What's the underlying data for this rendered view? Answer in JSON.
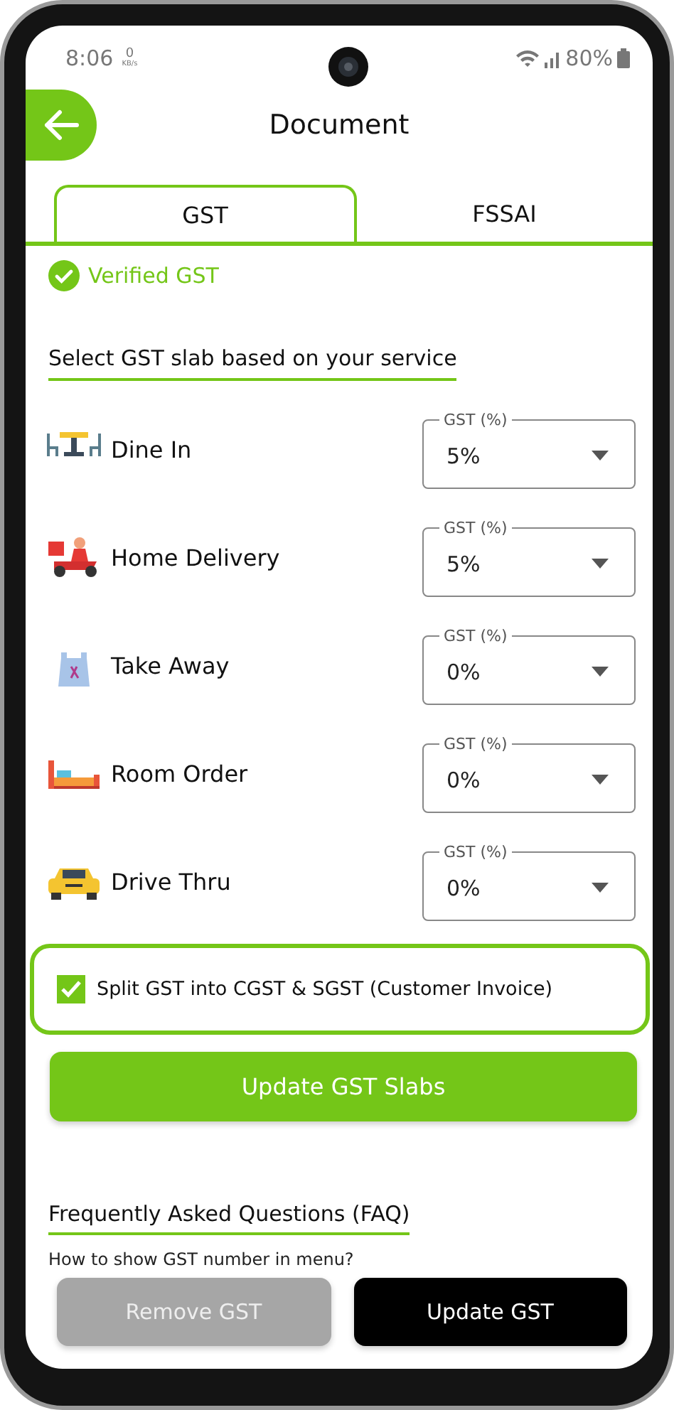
{
  "status_bar": {
    "time": "8:06",
    "net_speed_value": "0",
    "net_speed_unit": "KB/s",
    "battery": "80%"
  },
  "header": {
    "title": "Document"
  },
  "tabs": [
    {
      "label": "GST",
      "selected": true
    },
    {
      "label": "FSSAI",
      "selected": false
    }
  ],
  "verification": {
    "label": "Verified GST",
    "checked": true
  },
  "slab_section": {
    "heading": "Select GST slab based on your service"
  },
  "services": [
    {
      "kind": "dine",
      "name": "Dine In",
      "field_label": "GST (%)",
      "value": "5%"
    },
    {
      "kind": "delivery",
      "name": "Home Delivery",
      "field_label": "GST (%)",
      "value": "5%"
    },
    {
      "kind": "takeaway",
      "name": "Take Away",
      "field_label": "GST (%)",
      "value": "0%"
    },
    {
      "kind": "room",
      "name": "Room Order",
      "field_label": "GST (%)",
      "value": "0%"
    },
    {
      "kind": "drive",
      "name": "Drive Thru",
      "field_label": "GST (%)",
      "value": "0%"
    }
  ],
  "split_option": {
    "label": "Split GST into CGST & SGST (Customer Invoice)",
    "checked": true
  },
  "update_slabs_button": "Update GST Slabs",
  "faq": {
    "heading": "Frequently Asked Questions (FAQ)",
    "questions": [
      {
        "question": "How to show GST number in menu?"
      }
    ]
  },
  "footer_buttons": [
    {
      "label": "Remove GST",
      "disabled": true
    },
    {
      "label": "Update GST",
      "disabled": false
    }
  ]
}
